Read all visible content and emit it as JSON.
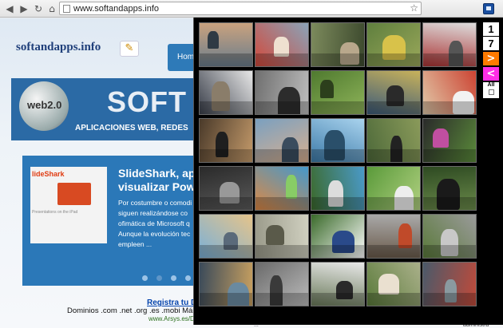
{
  "browser": {
    "url": "www.softandapps.info",
    "back_icon": "back-arrow-icon",
    "forward_icon": "forward-arrow-icon",
    "reload_icon": "reload-icon",
    "home_icon": "home-icon",
    "star_icon": "bookmark-star-icon",
    "extension_icon": "extension-icon"
  },
  "site": {
    "logo": "softandapps.info",
    "nav_home": "Home",
    "banner_word": "SOFT",
    "banner_badge": "web2.0",
    "banner_sub": "APLICACIONES WEB, REDES",
    "slide": {
      "title_line1": "SlideShark, apl",
      "title_line2": "visualizar Powe",
      "brand": "lideShark",
      "shot_caption": "Presentations on the iPad",
      "text": "Por costumbre o comodi siguen realizándose co ofimática de Microsoft q Aunque la evolución tec empleen ..."
    },
    "register_link": "Registra tu D",
    "domains_text": "Dominios .com .net .org .es .mobi Más c",
    "arsys_link": "www.Arsys.es/D",
    "bottom_text_1": "...",
    "bottom_text_2": "administra"
  },
  "popup": {
    "page_number_top": "1",
    "page_number_bottom": "7",
    "next_label": ">",
    "prev_label": "<",
    "all_label": "All",
    "colors": {
      "next": "#ff7a00",
      "prev": "#ff2ee6"
    }
  }
}
